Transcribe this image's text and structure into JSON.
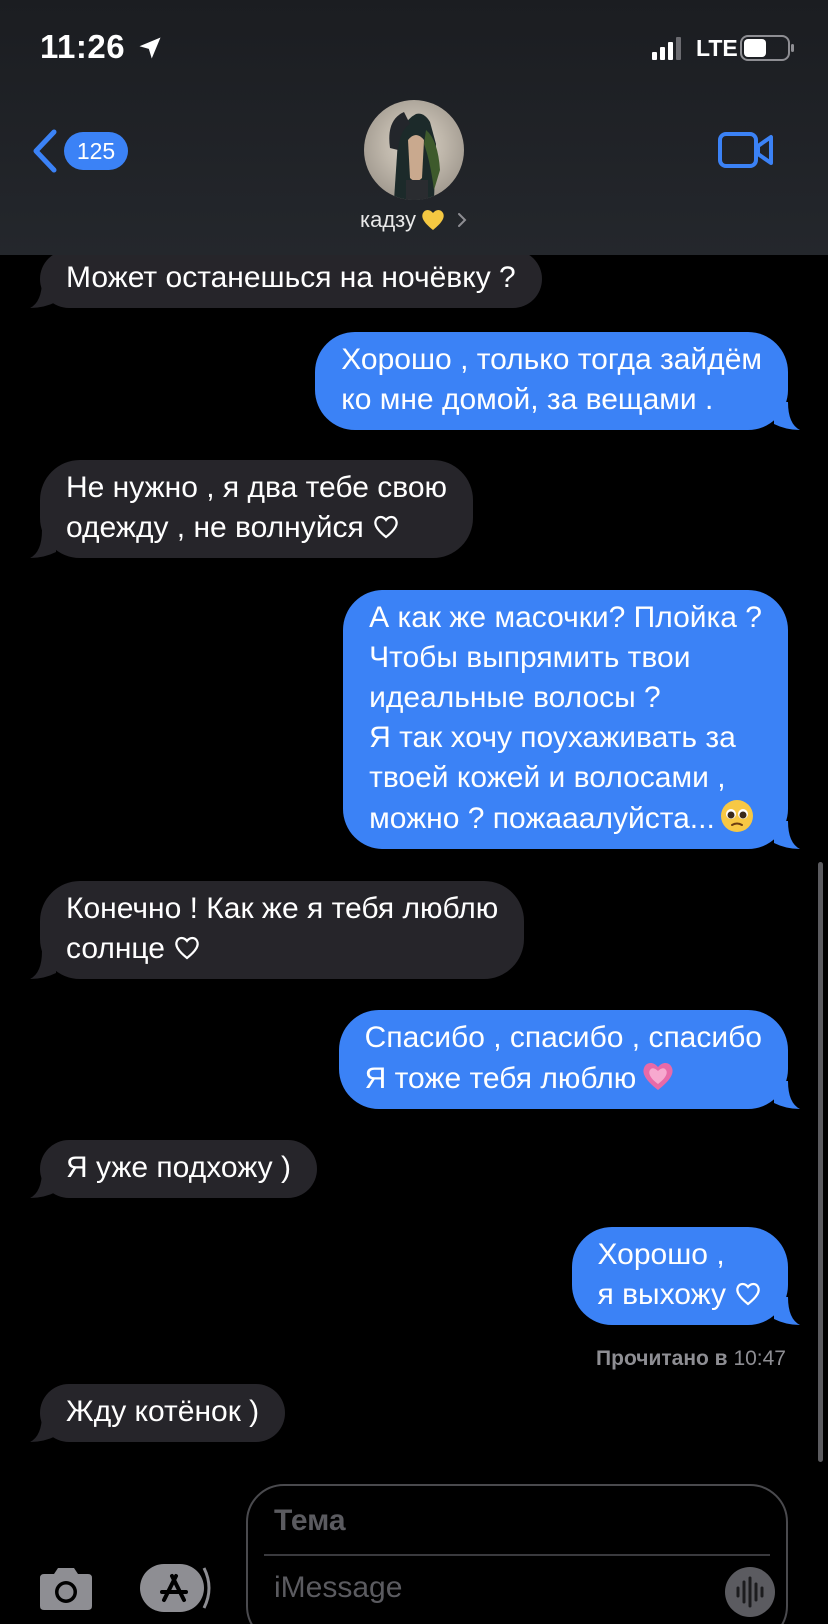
{
  "status_bar": {
    "time": "11:26",
    "network": "LTE"
  },
  "header": {
    "back_count": "125",
    "contact_name": "кадзу",
    "contact_emoji": "yellow-heart-icon"
  },
  "messages": [
    {
      "direction": "in",
      "lines": [
        "Может останешься на ночёвку ?"
      ]
    },
    {
      "direction": "out",
      "lines": [
        "Хорошо , только тогда зайдём",
        "ко мне домой, за вещами ."
      ]
    },
    {
      "direction": "in",
      "lines": [
        "Не нужно , я два тебе свою",
        "одежду , не волнуйся"
      ],
      "trailing_icon": "heart-outline-icon"
    },
    {
      "direction": "out",
      "lines": [
        "А как же масочки? Плойка ?",
        "Чтобы выпрямить твои",
        "идеальные волосы ?",
        "Я так хочу поухаживать за",
        "твоей кожей и волосами ,",
        "можно ? пожааалуйста..."
      ],
      "trailing_icon": "pleading-face-icon"
    },
    {
      "direction": "in",
      "lines": [
        "Конечно ! Как же я тебя люблю",
        "солнце"
      ],
      "trailing_icon": "heart-outline-icon"
    },
    {
      "direction": "out",
      "lines": [
        "Спасибо , спасибо , спасибо",
        "Я тоже тебя люблю"
      ],
      "trailing_icon": "pink-heart-icon"
    },
    {
      "direction": "in",
      "lines": [
        "Я уже подхожу )"
      ]
    },
    {
      "direction": "out",
      "lines": [
        "Хорошо ,",
        "я выхожу"
      ],
      "trailing_icon": "heart-outline-icon"
    },
    {
      "direction": "in",
      "lines": [
        "Жду котёнок )"
      ]
    }
  ],
  "read_receipt": {
    "label": "Прочитано в",
    "time": "10:47"
  },
  "input": {
    "subject_placeholder": "Тема",
    "message_placeholder": "iMessage"
  },
  "colors": {
    "outgoing_bubble": "#3b82f6",
    "incoming_bubble": "#26252a",
    "background": "#000000"
  }
}
